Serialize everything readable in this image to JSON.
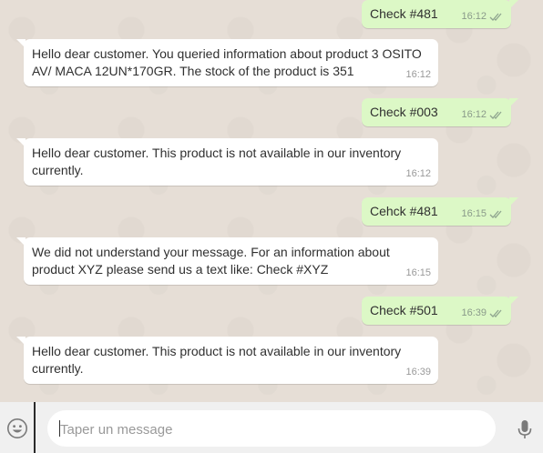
{
  "conversation": {
    "messages": [
      {
        "direction": "outgoing",
        "text": "Check #481",
        "time": "16:12",
        "status": "read"
      },
      {
        "direction": "incoming",
        "text": "Hello dear customer. You queried information about product 3 OSITO AV/ MACA 12UN*170GR. The stock of the product is 351",
        "time": "16:12"
      },
      {
        "direction": "outgoing",
        "text": "Check #003",
        "time": "16:12",
        "status": "read"
      },
      {
        "direction": "incoming",
        "text": "Hello dear customer. This product is not available in our inventory currently.",
        "time": "16:12"
      },
      {
        "direction": "outgoing",
        "text": "Cehck #481",
        "time": "16:15",
        "status": "read"
      },
      {
        "direction": "incoming",
        "text": "We did not understand your message. For an information about product XYZ please send us a text like: Check #XYZ",
        "time": "16:15"
      },
      {
        "direction": "outgoing",
        "text": "Check #501",
        "time": "16:39",
        "status": "read"
      },
      {
        "direction": "incoming",
        "text": "Hello dear customer. This product is not available in our inventory currently.",
        "time": "16:39"
      }
    ]
  },
  "composer": {
    "placeholder": "Taper un message",
    "value": "",
    "emoji_icon": "emoji-smiley-icon",
    "mic_icon": "microphone-icon"
  },
  "colors": {
    "outgoing_bubble": "#dcf8c6",
    "incoming_bubble": "#ffffff",
    "chat_background": "#e6ded6",
    "read_tick": "#8fa58f"
  }
}
